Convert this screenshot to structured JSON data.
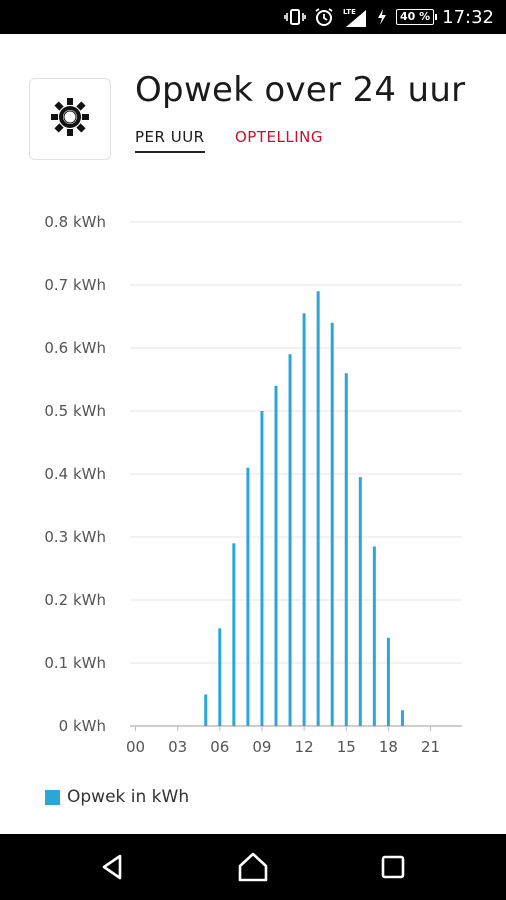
{
  "status_bar": {
    "time": "17:32",
    "battery": "40 %",
    "network": "LTE",
    "icons": [
      "vibrate-icon",
      "alarm-icon",
      "signal-icon",
      "charging-icon",
      "battery-icon"
    ]
  },
  "header": {
    "icon": "sun-icon",
    "title": "Opwek over 24 uur"
  },
  "tabs": [
    {
      "label": "PER UUR",
      "active": true
    },
    {
      "label": "OPTELLING",
      "active": false
    }
  ],
  "colors": {
    "accent": "#c8102e",
    "bar": "#2aa6d8",
    "grid": "#e6e6e6",
    "axis": "#bdbdbd"
  },
  "chart_data": {
    "type": "bar",
    "title": "",
    "xlabel": "",
    "ylabel": "",
    "unit": "kWh",
    "ylim": [
      0,
      0.8
    ],
    "y_ticks": [
      "0 kWh",
      "0.1 kWh",
      "0.2 kWh",
      "0.3 kWh",
      "0.4 kWh",
      "0.5 kWh",
      "0.6 kWh",
      "0.7 kWh",
      "0.8 kWh"
    ],
    "x_ticks": [
      "00",
      "03",
      "06",
      "09",
      "12",
      "15",
      "18",
      "21"
    ],
    "grid": true,
    "legend_position": "bottom-left",
    "categories": [
      0,
      1,
      2,
      3,
      4,
      5,
      6,
      7,
      8,
      9,
      10,
      11,
      12,
      13,
      14,
      15,
      16,
      17,
      18,
      19,
      20,
      21,
      22,
      23
    ],
    "series": [
      {
        "name": "Opwek in kWh",
        "values": [
          0,
          0,
          0,
          0,
          0,
          0.05,
          0.155,
          0.29,
          0.41,
          0.5,
          0.54,
          0.59,
          0.655,
          0.69,
          0.64,
          0.56,
          0.395,
          0.285,
          0.14,
          0.025,
          0,
          0,
          0,
          0
        ]
      }
    ]
  },
  "legend": {
    "label": "Opwek in kWh"
  },
  "nav_bar": {
    "icons": [
      "back-icon",
      "home-icon",
      "recents-icon"
    ]
  }
}
